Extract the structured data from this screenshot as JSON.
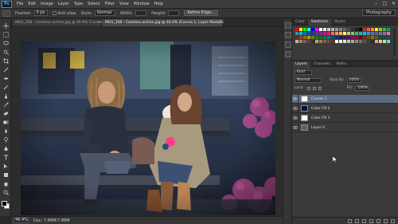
{
  "app": {
    "logo": "Ps",
    "menu": [
      "File",
      "Edit",
      "Image",
      "Layer",
      "Type",
      "Select",
      "Filter",
      "View",
      "Window",
      "Help"
    ],
    "window_controls": [
      "–",
      "□",
      "✕"
    ]
  },
  "options_bar": {
    "feather_label": "Feather:",
    "feather_value": "0 px",
    "antialias_label": "Anti-alias",
    "style_label": "Style:",
    "style_value": "Normal",
    "width_label": "Width:",
    "height_label": "Height:",
    "refine_label": "Refine Edge...",
    "workspace": "Photography"
  },
  "documents": {
    "tabs": [
      {
        "label": "MGV_108 - Careless.achive.jpg @ 46.4% (Curves 1,..",
        "active": false
      },
      {
        "label": "MGV_108 - Careless.achive.jpg @ 46.4% (Curves 1, Layer Mask/8)",
        "active": true
      }
    ]
  },
  "status": {
    "zoom": "46.4%",
    "doc_info": "Doc: 7.88M/7.88M"
  },
  "tools": [
    "move-icon",
    "marquee-icon",
    "lasso-icon",
    "quick-select-icon",
    "crop-icon",
    "eyedropper-icon",
    "healing-icon",
    "brush-icon",
    "clone-stamp-icon",
    "history-brush-icon",
    "eraser-icon",
    "gradient-icon",
    "blur-icon",
    "dodge-icon",
    "pen-icon",
    "type-icon",
    "path-select-icon",
    "shape-icon",
    "hand-icon",
    "zoom-icon"
  ],
  "colors": {
    "foreground": "#000000",
    "background": "#ffffff",
    "selected_layer": "#5a6b82",
    "panel": "#3a3a3a"
  },
  "swatches_panel": {
    "tabs": [
      "Color",
      "Swatches",
      "Styles"
    ],
    "active_tab": "Swatches",
    "colors": [
      "#ff0000",
      "#ffff00",
      "#00ff00",
      "#00ffff",
      "#0000ff",
      "#ff00ff",
      "#ffffff",
      "#e6e6e6",
      "#cccccc",
      "#b3b3b3",
      "#999999",
      "#808080",
      "#666666",
      "#4d4d4d",
      "#333333",
      "#1a1a1a",
      "#000000",
      "#ed1c24",
      "#f26522",
      "#f7941d",
      "#fff200",
      "#8dc63f",
      "#39b54a",
      "#00a651",
      "#00a99d",
      "#00aeef",
      "#0072bc",
      "#0054a6",
      "#2e3192",
      "#662d91",
      "#92278f",
      "#ec008c",
      "#ed145b",
      "#f26c4f",
      "#f68e56",
      "#fbaf5d",
      "#fff568",
      "#acd373",
      "#7cc576",
      "#3cb878",
      "#1cbbb4",
      "#00bff3",
      "#448ccb",
      "#5674b9",
      "#605ca8",
      "#8560a8",
      "#a864a8",
      "#f06eaa",
      "#9e0b0f",
      "#a0410d",
      "#a36209",
      "#aba000",
      "#598527",
      "#197b30",
      "#007236",
      "#00746b",
      "#0076a3",
      "#004a80",
      "#003471",
      "#1b1464",
      "#440e62",
      "#630460",
      "#9e005d",
      "#9e0039",
      "#790000",
      "#7b2e00",
      "#7d4900",
      "#827b00",
      "#406618",
      "#005e20",
      "#005826",
      "#005952",
      "#c7b299",
      "#998675",
      "#736357",
      "#534741",
      "#362f2d",
      "#c69c6d",
      "#a67c52",
      "#8c6239",
      "#754c24",
      "#603913",
      "#ffffff",
      "#f2f2f2",
      "#e0e0e0",
      "#c2c2c2",
      "#a6a6a6",
      "#8a8a8a",
      "#707070",
      "#575757",
      "#424242",
      "#2b2b2b",
      "#f5989d",
      "#fdc689",
      "#c4df9b",
      "#6dcff6"
    ]
  },
  "layers_panel": {
    "tabs": [
      "Layers",
      "Channels",
      "Paths"
    ],
    "active_tab": "Layers",
    "kind_label": "Kind",
    "blend_mode": "Normal",
    "opacity_label": "Opacity:",
    "opacity_value": "100%",
    "lock_label": "Lock:",
    "fill_label": "Fill:",
    "fill_value": "100%",
    "layers": [
      {
        "name": "Curves 1",
        "selected": true,
        "thumb": "#ffffff"
      },
      {
        "name": "Color Fill 2",
        "selected": false,
        "thumb": "#0b0f3a"
      },
      {
        "name": "Color Fill 1",
        "selected": false,
        "thumb": "#ffffff"
      },
      {
        "name": "Layer 0",
        "selected": false,
        "thumb": "#6b6056"
      }
    ]
  }
}
